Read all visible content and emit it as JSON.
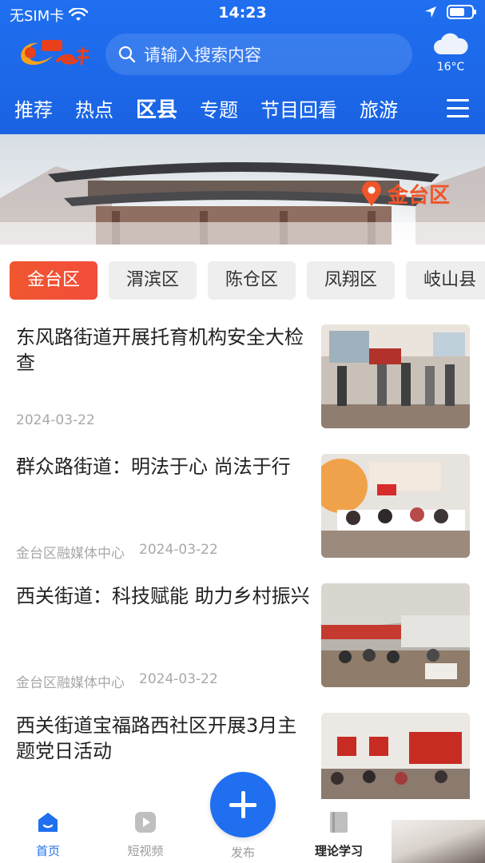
{
  "status_bar": {
    "carrier": "无SIM卡",
    "time": "14:23"
  },
  "header": {
    "search_placeholder": "请输入搜索内容",
    "weather_temp": "16°C",
    "nav_tabs": [
      {
        "label": "推荐",
        "active": false
      },
      {
        "label": "热点",
        "active": false
      },
      {
        "label": "区县",
        "active": true
      },
      {
        "label": "专题",
        "active": false
      },
      {
        "label": "节目回看",
        "active": false
      },
      {
        "label": "旅游",
        "active": false
      }
    ]
  },
  "banner": {
    "location": "金台区"
  },
  "districts": [
    {
      "label": "金台区",
      "active": true
    },
    {
      "label": "渭滨区",
      "active": false
    },
    {
      "label": "陈仓区",
      "active": false
    },
    {
      "label": "凤翔区",
      "active": false
    },
    {
      "label": "岐山县",
      "active": false
    }
  ],
  "news": [
    {
      "title": "东风路街道开展托育机构安全大检查",
      "source": "",
      "date": "2024-03-22"
    },
    {
      "title": "群众路街道：明法于心  尚法于行",
      "source": "金台区融媒体中心",
      "date": "2024-03-22"
    },
    {
      "title": "西关街道：科技赋能   助力乡村振兴",
      "source": "金台区融媒体中心",
      "date": "2024-03-22"
    },
    {
      "title": "西关街道宝福路西社区开展3月主题党日活动",
      "source": "",
      "date": ""
    }
  ],
  "bottom_nav": {
    "home": "首页",
    "short_video": "短视频",
    "publish": "发布",
    "theory_study": "理论学习"
  },
  "colors": {
    "brand_blue": "#1f6ff0",
    "accent_orange": "#f0552a"
  }
}
